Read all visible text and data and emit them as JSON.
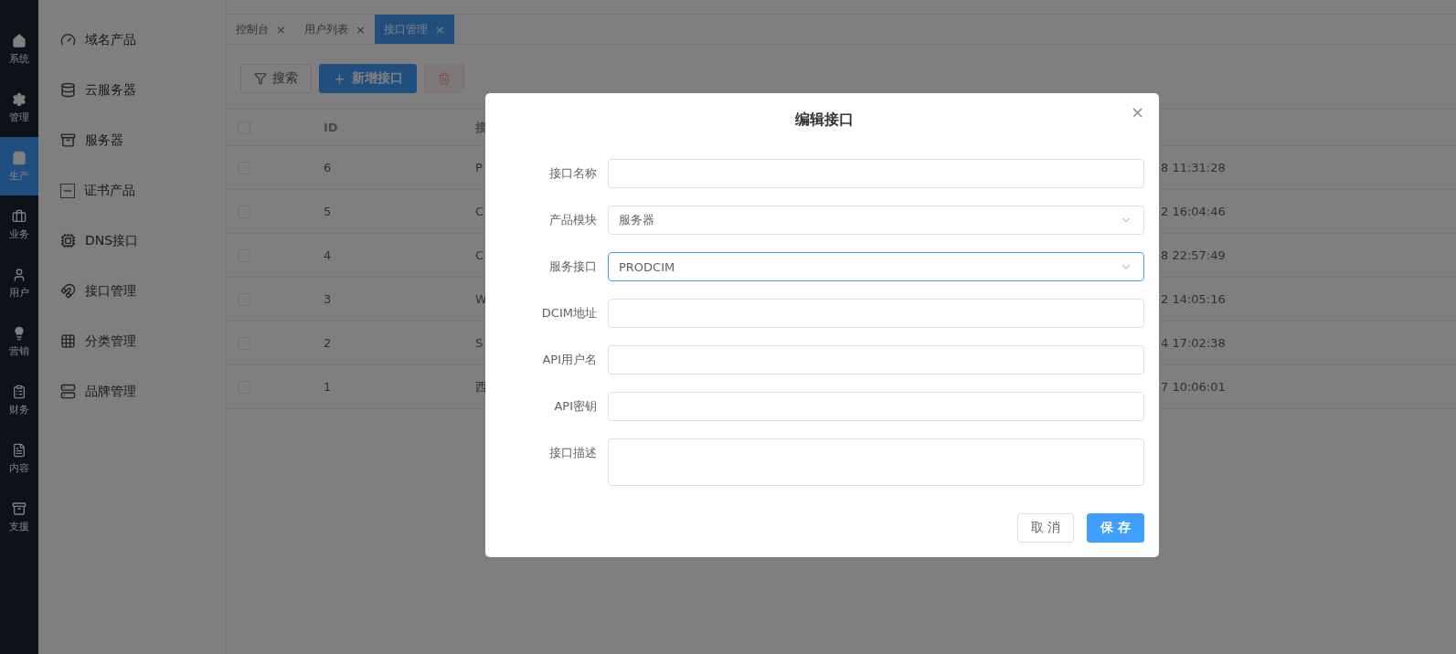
{
  "main_nav": [
    {
      "label": "系统",
      "selected": false
    },
    {
      "label": "管理",
      "selected": false
    },
    {
      "label": "生产",
      "selected": true
    },
    {
      "label": "业务",
      "selected": false
    },
    {
      "label": "用户",
      "selected": false
    },
    {
      "label": "营销",
      "selected": false
    },
    {
      "label": "财务",
      "selected": false
    },
    {
      "label": "内容",
      "selected": false
    },
    {
      "label": "支援",
      "selected": false
    }
  ],
  "sub_nav": [
    {
      "label": "域名产品"
    },
    {
      "label": "云服务器"
    },
    {
      "label": "服务器"
    },
    {
      "label": "证书产品"
    },
    {
      "label": "DNS接口"
    },
    {
      "label": "接口管理"
    },
    {
      "label": "分类管理"
    },
    {
      "label": "品牌管理"
    }
  ],
  "tabs": [
    {
      "label": "控制台",
      "selected": false,
      "close": "×"
    },
    {
      "label": "用户列表",
      "selected": false,
      "close": "×"
    },
    {
      "label": "接口管理",
      "selected": true,
      "close": "×"
    }
  ],
  "toolbar": {
    "search_button": "搜索",
    "add_button": "新增接口",
    "delete_disabled": true
  },
  "table": {
    "header_checked": false,
    "columns": [
      "ID",
      "接"
    ],
    "rows": [
      {
        "checked": false,
        "id": "6",
        "column_3": "P",
        "time": "8 11:31:28"
      },
      {
        "checked": false,
        "id": "5",
        "column_3": "C",
        "time": "2 16:04:46"
      },
      {
        "checked": false,
        "id": "4",
        "column_3": "C",
        "time": "8 22:57:49"
      },
      {
        "checked": false,
        "id": "3",
        "column_3": "W",
        "time": "2 14:05:16"
      },
      {
        "checked": false,
        "id": "2",
        "column_3": "S",
        "time": "4 17:02:38"
      },
      {
        "checked": false,
        "id": "1",
        "column_3": "西",
        "time": "7 10:06:01"
      }
    ]
  },
  "dialog": {
    "title": "编辑接口",
    "close": "×",
    "fields": [
      {
        "label": "接口名称",
        "kind": "input",
        "focused": false
      },
      {
        "label": "产品模块",
        "kind": "select",
        "value": "服务器",
        "focused": false
      },
      {
        "label": "服务接口",
        "kind": "select",
        "value": "PRODCIM",
        "focused": true
      },
      {
        "label": "DCIM地址",
        "kind": "input",
        "focused": false
      },
      {
        "label": "API用户名",
        "kind": "input",
        "focused": false
      },
      {
        "label": "API密钥",
        "kind": "input",
        "focused": false
      },
      {
        "label": "接口描述",
        "kind": "textarea",
        "focused": false
      }
    ],
    "cancel_button": "取 消",
    "save_button": "保 存"
  }
}
